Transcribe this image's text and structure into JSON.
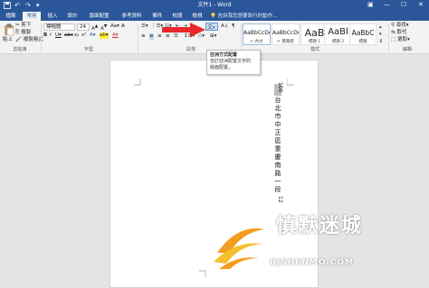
{
  "titlebar": {
    "title": "文件1 - Word",
    "undo": "↶",
    "redo": "↷",
    "qa_menu": "▾",
    "ribbon_display": "▣",
    "minimize": "—",
    "maximize": "☐",
    "close": "✕",
    "accent": "#2b579a"
  },
  "tabs": [
    "檔案",
    "常用",
    "插入",
    "設計",
    "版面配置",
    "參考資料",
    "郵件",
    "校閱",
    "檢視"
  ],
  "active_tab": "常用",
  "tell_me": "告訴我您想要執行的動作...",
  "clipboard": {
    "paste_label": "貼上",
    "cut_label": "剪下",
    "copy_label": "複製",
    "format_painter_label": "複製格式",
    "group_label": "剪貼簿"
  },
  "font": {
    "font_name": "標楷體",
    "font_size": "24",
    "group_label": "字型"
  },
  "paragraph": {
    "group_label": "段落"
  },
  "styles": {
    "tiles": [
      {
        "sample": "AaBbCcDd",
        "name": "↵ 內文"
      },
      {
        "sample": "AaBbCcDd",
        "name": "↵ 無間距"
      },
      {
        "sample": "AaB",
        "name": "標題 1"
      },
      {
        "sample": "AaBl",
        "name": "標題 2"
      },
      {
        "sample": "AaBbC",
        "name": "標題"
      }
    ],
    "group_label": "樣式"
  },
  "editing": {
    "find_label": "尋找",
    "replace_label": "取代",
    "select_label": "選取",
    "group_label": "編輯"
  },
  "tooltip": {
    "title": "亞洲方式配置",
    "body_line1": "自訂亞洲配置文字的",
    "body_line2": "版面配置。"
  },
  "document": {
    "vertical_text": [
      "100",
      "台",
      "北",
      "市",
      "中",
      "正",
      "區",
      "重",
      "慶",
      "南",
      "路",
      "一",
      "段",
      "12"
    ]
  },
  "watermark": {
    "name": "慎默迷城",
    "url": "BJSHENMO.COM"
  },
  "colors": {
    "arrow": "#e8262b",
    "logo_orange": "#f39c1f",
    "logo_yellow": "#f6c02c"
  }
}
